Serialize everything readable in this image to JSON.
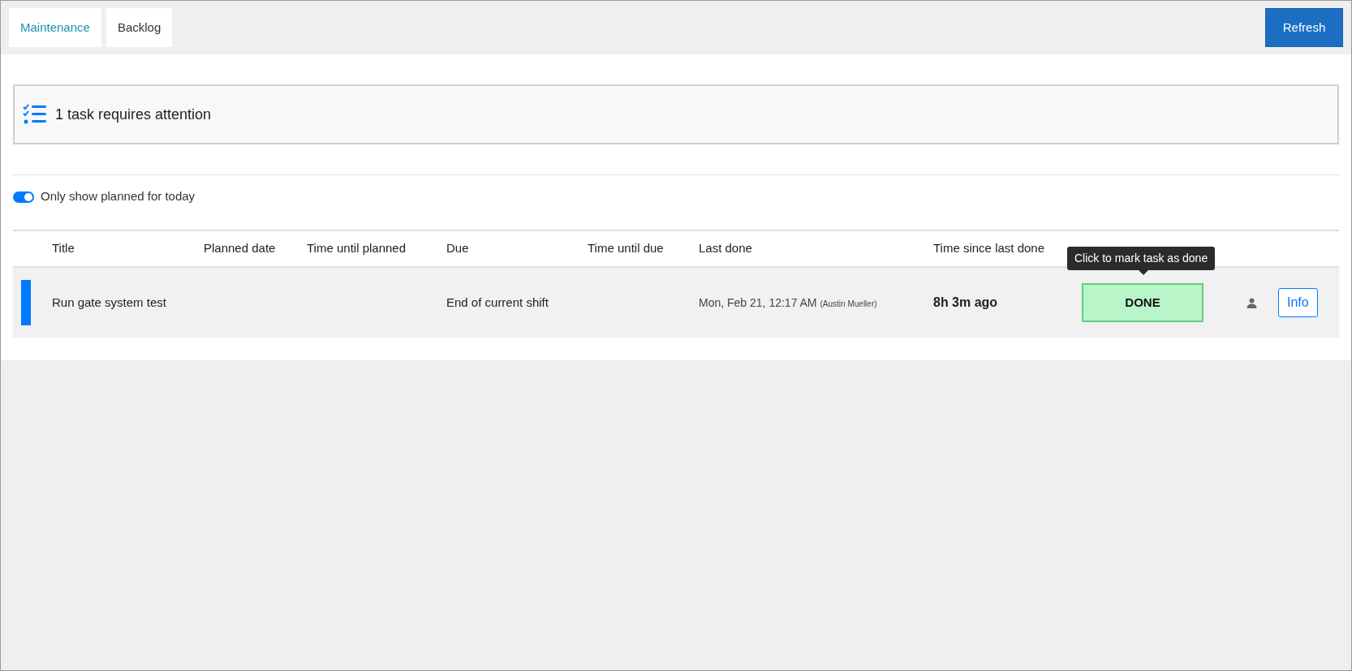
{
  "tabs": [
    {
      "label": "Maintenance",
      "selected": true
    },
    {
      "label": "Backlog",
      "selected": false
    }
  ],
  "refresh_button": "Refresh",
  "alert": {
    "text": "1 task requires attention"
  },
  "filter": {
    "label": "Only show planned for today",
    "on": true
  },
  "table": {
    "columns": [
      "Title",
      "Planned date",
      "Time until planned",
      "Due",
      "Time until due",
      "Last done",
      "Time since last done"
    ],
    "rows": [
      {
        "color": "#007bff",
        "title": "Run gate system test",
        "planned_date": "",
        "time_until_planned": "",
        "due": "End of current shift",
        "time_until_due": "",
        "last_done": "Mon, Feb 21, 12:17 AM",
        "last_done_by": "(Austin Mueller)",
        "time_since_last_done": "8h 3m ago",
        "done_button": "DONE",
        "done_tooltip": "Click to mark task as done",
        "info_button": "Info"
      }
    ]
  }
}
